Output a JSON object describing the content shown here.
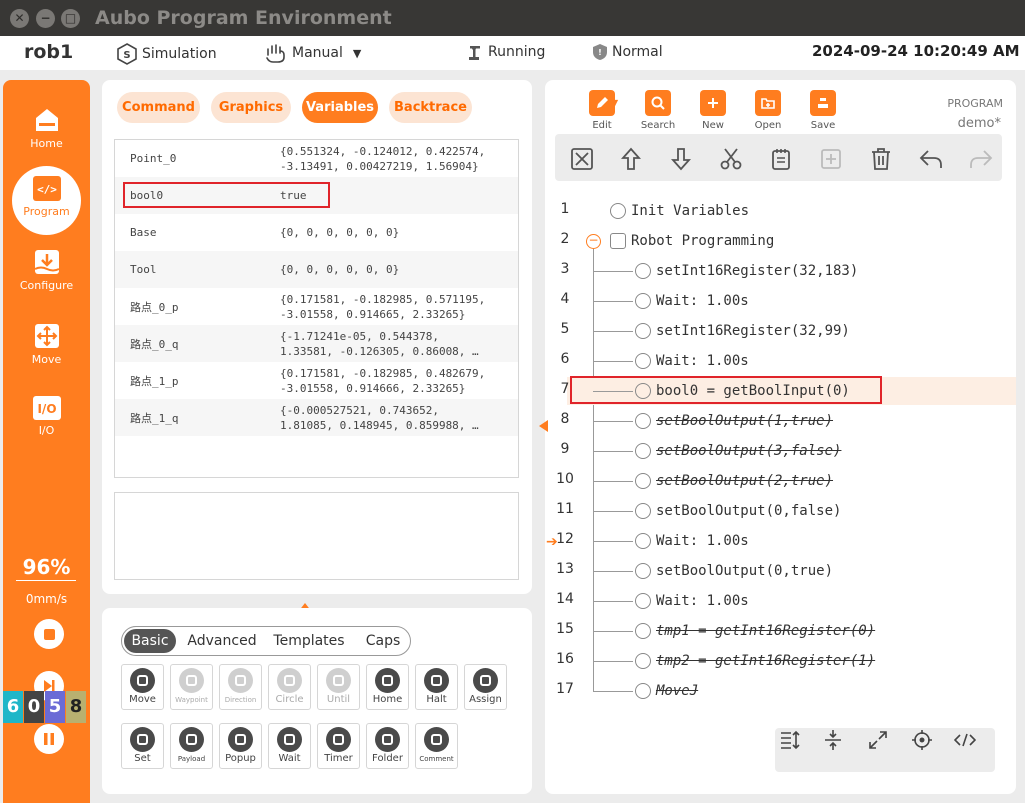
{
  "window": {
    "title": "Aubo Program Environment"
  },
  "status": {
    "robot": "rob1",
    "mode": "Simulation",
    "control": "Manual",
    "state": "Running",
    "safety": "Normal",
    "datetime": "2024-09-24 10:20:49 AM"
  },
  "sidebar": {
    "items": [
      {
        "label": "Home",
        "icon": "home-icon"
      },
      {
        "label": "Program",
        "icon": "code-icon"
      },
      {
        "label": "Configure",
        "icon": "download-icon"
      },
      {
        "label": "Move",
        "icon": "move-arrows-icon"
      },
      {
        "label": "I/O",
        "icon": "io-icon"
      }
    ],
    "speed_percent": "96%",
    "speed_mm": "0mm/s",
    "digits": [
      "6",
      "0",
      "5",
      "8"
    ],
    "digit_colors": [
      "#1fb6c8",
      "#444444",
      "#6b6bd6",
      "#8a8a40"
    ]
  },
  "left_tabs": [
    {
      "label": "Command",
      "active": false
    },
    {
      "label": "Graphics",
      "active": false
    },
    {
      "label": "Variables",
      "active": true
    },
    {
      "label": "Backtrace",
      "active": false
    }
  ],
  "variables": [
    {
      "name": "Point_0",
      "value": "{0.551324, -0.124012, 0.422574,\n-3.13491, 0.00427219, 1.56904}"
    },
    {
      "name": "bool0",
      "value": "true"
    },
    {
      "name": "Base",
      "value": "{0, 0, 0, 0, 0, 0}"
    },
    {
      "name": "Tool",
      "value": "{0, 0, 0, 0, 0, 0}"
    },
    {
      "name": "路点_0_p",
      "value": "{0.171581, -0.182985, 0.571195,\n-3.01558, 0.914665, 2.33265}"
    },
    {
      "name": "路点_0_q",
      "value": "{-1.71241e-05, 0.544378,\n1.33581, -0.126305, 0.86008, …"
    },
    {
      "name": "路点_1_p",
      "value": "{0.171581, -0.182985, 0.482679,\n-3.01558, 0.914666, 2.33265}"
    },
    {
      "name": "路点_1_q",
      "value": "{-0.000527521, 0.743652,\n1.81085, 0.148945, 0.859988, …"
    }
  ],
  "cmd_tabs": [
    {
      "label": "Basic",
      "active": true
    },
    {
      "label": "Advanced",
      "active": false
    },
    {
      "label": "Templates",
      "active": false
    },
    {
      "label": "Caps",
      "active": false
    }
  ],
  "commands": [
    {
      "label": "Move",
      "enabled": true,
      "small": false
    },
    {
      "label": "Waypoint",
      "enabled": false,
      "small": true
    },
    {
      "label": "Direction",
      "enabled": false,
      "small": true
    },
    {
      "label": "Circle",
      "enabled": false,
      "small": false
    },
    {
      "label": "Until",
      "enabled": false,
      "small": false
    },
    {
      "label": "Home",
      "enabled": true,
      "small": false
    },
    {
      "label": "Halt",
      "enabled": true,
      "small": false
    },
    {
      "label": "Assign",
      "enabled": true,
      "small": false
    },
    {
      "label": "Set",
      "enabled": true,
      "small": false
    },
    {
      "label": "Payload",
      "enabled": true,
      "small": true
    },
    {
      "label": "Popup",
      "enabled": true,
      "small": false
    },
    {
      "label": "Wait",
      "enabled": true,
      "small": false
    },
    {
      "label": "Timer",
      "enabled": true,
      "small": false
    },
    {
      "label": "Folder",
      "enabled": true,
      "small": false
    },
    {
      "label": "Comment",
      "enabled": true,
      "small": true
    }
  ],
  "toolbar": [
    {
      "label": "Edit",
      "icon": "edit-icon"
    },
    {
      "label": "Search",
      "icon": "search-icon"
    },
    {
      "label": "New",
      "icon": "new-file-icon"
    },
    {
      "label": "Open",
      "icon": "open-folder-icon"
    },
    {
      "label": "Save",
      "icon": "save-icon"
    }
  ],
  "program": {
    "caption": "PROGRAM",
    "name": "demo*"
  },
  "edit_tools": [
    {
      "name": "suppress",
      "icon": "suppress-icon",
      "enabled": true
    },
    {
      "name": "move-up",
      "icon": "arrow-up-icon",
      "enabled": true
    },
    {
      "name": "move-down",
      "icon": "arrow-down-icon",
      "enabled": true
    },
    {
      "name": "cut",
      "icon": "scissors-icon",
      "enabled": true
    },
    {
      "name": "copy",
      "icon": "copy-icon",
      "enabled": true
    },
    {
      "name": "paste",
      "icon": "paste-icon",
      "enabled": false
    },
    {
      "name": "delete",
      "icon": "trash-icon",
      "enabled": true
    },
    {
      "name": "undo",
      "icon": "undo-icon",
      "enabled": true
    },
    {
      "name": "redo",
      "icon": "redo-icon",
      "enabled": false
    }
  ],
  "code_lines": [
    {
      "n": "1",
      "text": "Init Variables",
      "level": 0,
      "disabled": false
    },
    {
      "n": "2",
      "text": "Robot Programming",
      "level": 0,
      "disabled": false
    },
    {
      "n": "3",
      "text": "setInt16Register(32,183)",
      "level": 1,
      "disabled": false
    },
    {
      "n": "4",
      "text": "Wait: 1.00s",
      "level": 1,
      "disabled": false
    },
    {
      "n": "5",
      "text": "setInt16Register(32,99)",
      "level": 1,
      "disabled": false
    },
    {
      "n": "6",
      "text": "Wait: 1.00s",
      "level": 1,
      "disabled": false
    },
    {
      "n": "7",
      "text": "bool0 = getBoolInput(0)",
      "level": 1,
      "disabled": false
    },
    {
      "n": "8",
      "text": "setBoolOutput(1,true)",
      "level": 1,
      "disabled": true
    },
    {
      "n": "9",
      "text": "setBoolOutput(3,false)",
      "level": 1,
      "disabled": true
    },
    {
      "n": "10",
      "text": "setBoolOutput(2,true)",
      "level": 1,
      "disabled": true
    },
    {
      "n": "11",
      "text": "setBoolOutput(0,false)",
      "level": 1,
      "disabled": false
    },
    {
      "n": "12",
      "text": "Wait: 1.00s",
      "level": 1,
      "disabled": false
    },
    {
      "n": "13",
      "text": "setBoolOutput(0,true)",
      "level": 1,
      "disabled": false
    },
    {
      "n": "14",
      "text": "Wait: 1.00s",
      "level": 1,
      "disabled": false
    },
    {
      "n": "15",
      "text": "tmp1 = getInt16Register(0)",
      "level": 1,
      "disabled": true
    },
    {
      "n": "16",
      "text": "tmp2 = getInt16Register(1)",
      "level": 1,
      "disabled": true
    },
    {
      "n": "17",
      "text": "MoveJ",
      "level": 1,
      "disabled": true
    }
  ],
  "current_line": "12",
  "selected_line": "7",
  "colors": {
    "accent": "#ff7d1f",
    "highlight": "#e0242a",
    "selected_row": "#fdeee3"
  },
  "bottom_tools": [
    {
      "icon": "expand-vertical-icon"
    },
    {
      "icon": "collapse-vertical-icon"
    },
    {
      "icon": "fullscreen-icon"
    },
    {
      "icon": "target-icon"
    },
    {
      "icon": "code-icon"
    }
  ]
}
